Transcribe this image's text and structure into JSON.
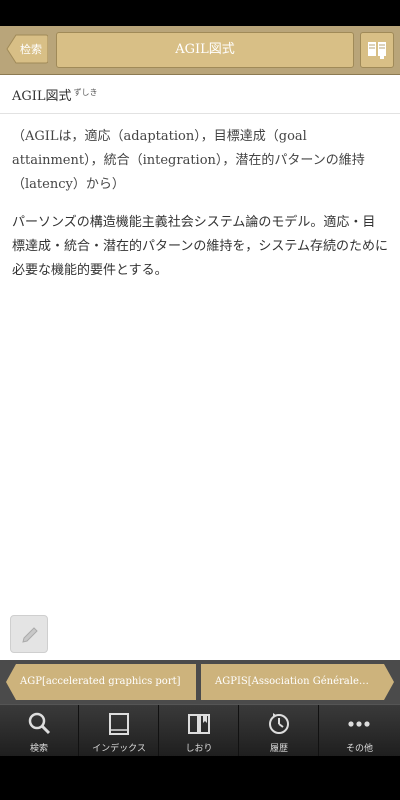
{
  "header": {
    "back_label": "检索",
    "title": "AGIL図式"
  },
  "entry": {
    "headword": "AGIL図式",
    "reading": "ずしき",
    "definition_1": "（AGILは，適応（adaptation），目標達成（goal attainment），統合（integration），潜在的パターンの維持（latency）から）",
    "definition_2": "パーソンズの構造機能主義社会システム論のモデル。適応・目標達成・統合・潜在的パターンの維持を，システム存続のために必要な機能的要件とする。"
  },
  "neighbors": {
    "previous": "AGP[accelerated graphics port]",
    "next": "AGPIS[Association Générale…"
  },
  "tabbar": {
    "items": [
      {
        "label": "検索",
        "icon": "search-icon"
      },
      {
        "label": "インデックス",
        "icon": "book-icon"
      },
      {
        "label": "しおり",
        "icon": "bookmark-icon"
      },
      {
        "label": "履歴",
        "icon": "history-icon"
      },
      {
        "label": "その他",
        "icon": "more-icon"
      }
    ]
  },
  "colors": {
    "accent": "#d8bf86",
    "navbar": "#b9a57a",
    "tabbar": "#2a2a2a"
  }
}
